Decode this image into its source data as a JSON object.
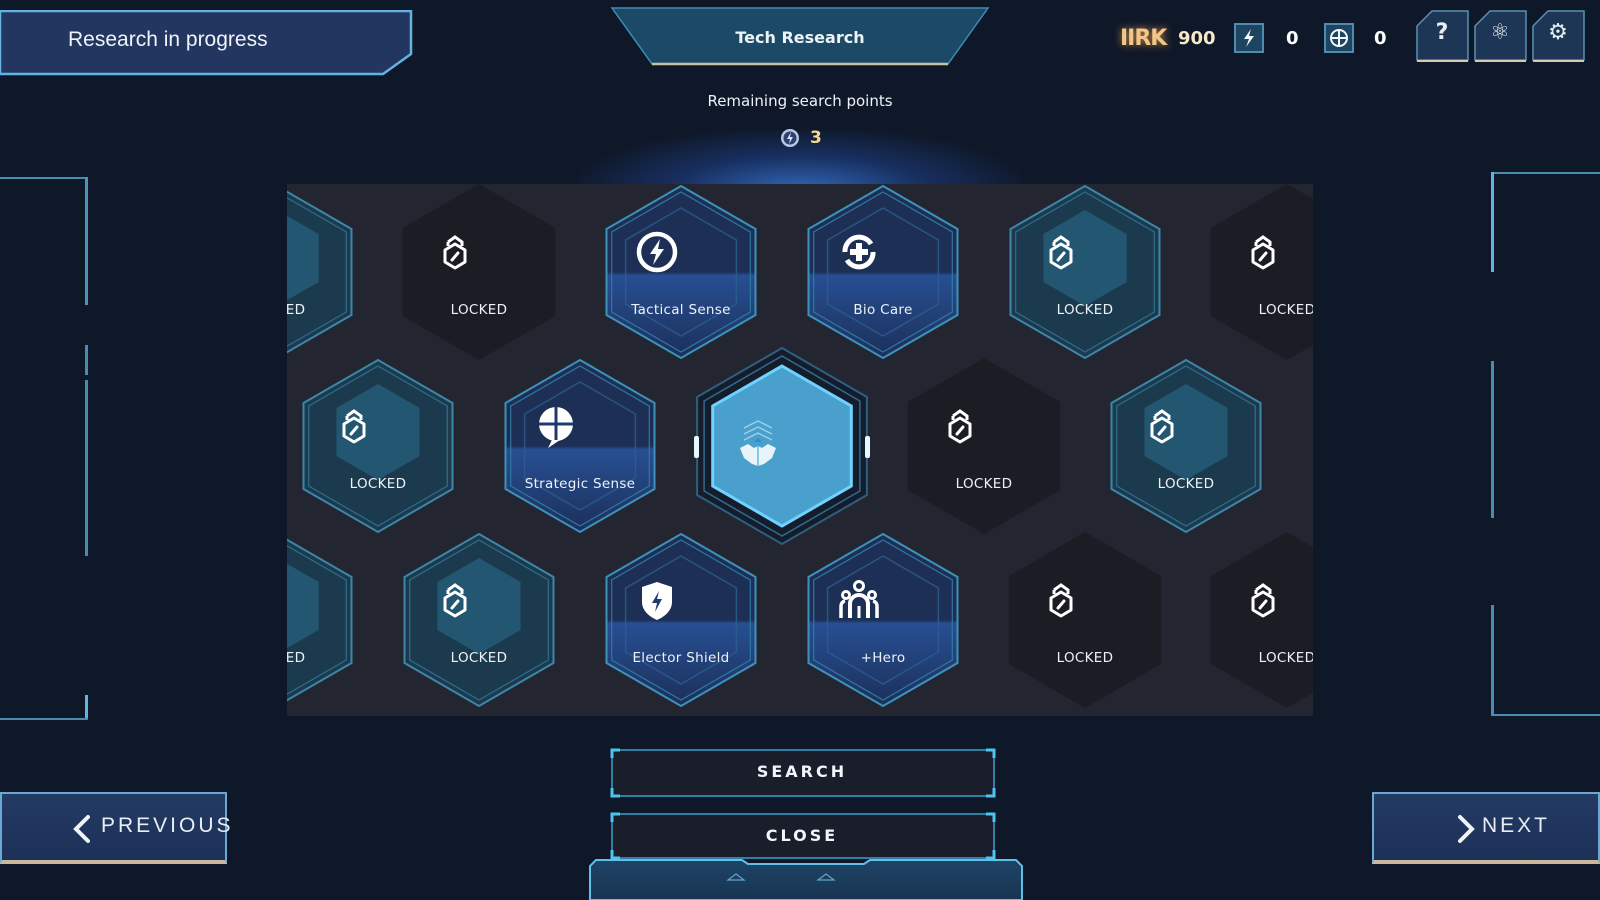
{
  "header": {
    "status_banner": "Research in progress",
    "title": "Tech Research"
  },
  "resources": {
    "currency_logo": "IIRK",
    "currency_value": "900",
    "lightning_icon": "lightning-badge-icon",
    "lightning_value": "0",
    "globe_icon": "globe-badge-icon",
    "globe_value": "0"
  },
  "corner_buttons": [
    {
      "name": "help-button",
      "icon": "question-icon",
      "glyph": "?"
    },
    {
      "name": "research-button",
      "icon": "atom-icon",
      "glyph": "⚛"
    },
    {
      "name": "settings-button",
      "icon": "gear-icon",
      "glyph": "⚙"
    }
  ],
  "remaining": {
    "label": "Remaining search points",
    "value": "3"
  },
  "grid": {
    "rows": [
      [
        {
          "label": "LOCKED",
          "state": "locked-lit",
          "icon": "lock"
        },
        {
          "label": "LOCKED",
          "state": "locked-dark",
          "icon": "lock"
        },
        {
          "label": "Tactical Sense",
          "state": "unlocked",
          "icon": "bolt-circle"
        },
        {
          "label": "Bio Care",
          "state": "unlocked",
          "icon": "bio-care"
        },
        {
          "label": "LOCKED",
          "state": "locked-lit",
          "icon": "lock"
        },
        {
          "label": "LOCKED",
          "state": "locked-dark",
          "icon": "lock"
        }
      ],
      [
        {
          "label": "LOCKED",
          "state": "locked-lit",
          "icon": "lock"
        },
        {
          "label": "Strategic Sense",
          "state": "unlocked",
          "icon": "globe-chat"
        },
        {
          "label": "",
          "state": "core",
          "icon": "emblem"
        },
        {
          "label": "LOCKED",
          "state": "locked-dark",
          "icon": "lock"
        },
        {
          "label": "LOCKED",
          "state": "locked-lit",
          "icon": "lock"
        }
      ],
      [
        {
          "label": "LOCKED",
          "state": "locked-lit",
          "icon": "lock"
        },
        {
          "label": "LOCKED",
          "state": "locked-lit",
          "icon": "lock"
        },
        {
          "label": "Elector Shield",
          "state": "unlocked",
          "icon": "shield-bolt"
        },
        {
          "label": "+Hero",
          "state": "unlocked",
          "icon": "hero-group"
        },
        {
          "label": "LOCKED",
          "state": "locked-dark",
          "icon": "lock"
        },
        {
          "label": "LOCKED",
          "state": "locked-dark",
          "icon": "lock"
        }
      ]
    ]
  },
  "actions": {
    "search_label": "SEARCH",
    "close_label": "CLOSE"
  },
  "nav": {
    "previous_label": "PREVIOUS",
    "next_label": "NEXT"
  }
}
